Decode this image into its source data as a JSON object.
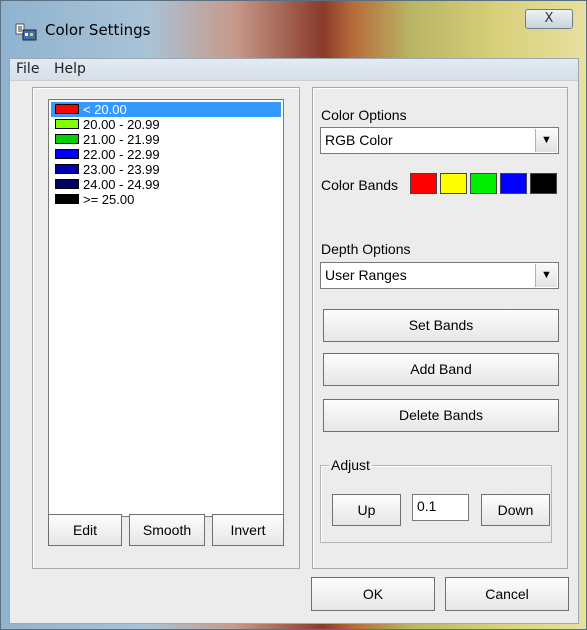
{
  "window": {
    "title": "Color Settings",
    "close_glyph": "X"
  },
  "menu": {
    "file": "File",
    "help": "Help"
  },
  "bands_list": {
    "items": [
      {
        "label": "< 20.00",
        "color": "#ff0000",
        "selected": true
      },
      {
        "label": "20.00 - 20.99",
        "color": "#7fff00"
      },
      {
        "label": "21.00 - 21.99",
        "color": "#00d000"
      },
      {
        "label": "22.00 - 22.99",
        "color": "#0000ff"
      },
      {
        "label": "23.00 - 23.99",
        "color": "#0000b0"
      },
      {
        "label": "24.00 - 24.99",
        "color": "#000060"
      },
      {
        "label": ">= 25.00",
        "color": "#000000"
      }
    ],
    "edit_label": "Edit",
    "smooth_label": "Smooth",
    "invert_label": "Invert"
  },
  "color_options": {
    "label": "Color Options",
    "value": "RGB Color",
    "bands_label": "Color Bands",
    "band_colors": [
      "#ff0000",
      "#ffff00",
      "#00ee00",
      "#0000ff",
      "#000000"
    ]
  },
  "depth_options": {
    "label": "Depth Options",
    "value": "User Ranges",
    "set_bands_label": "Set Bands",
    "add_band_label": "Add Band",
    "delete_bands_label": "Delete Bands"
  },
  "adjust": {
    "label": "Adjust",
    "up_label": "Up",
    "step_value": "0.1",
    "down_label": "Down"
  },
  "footer": {
    "ok_label": "OK",
    "cancel_label": "Cancel"
  }
}
